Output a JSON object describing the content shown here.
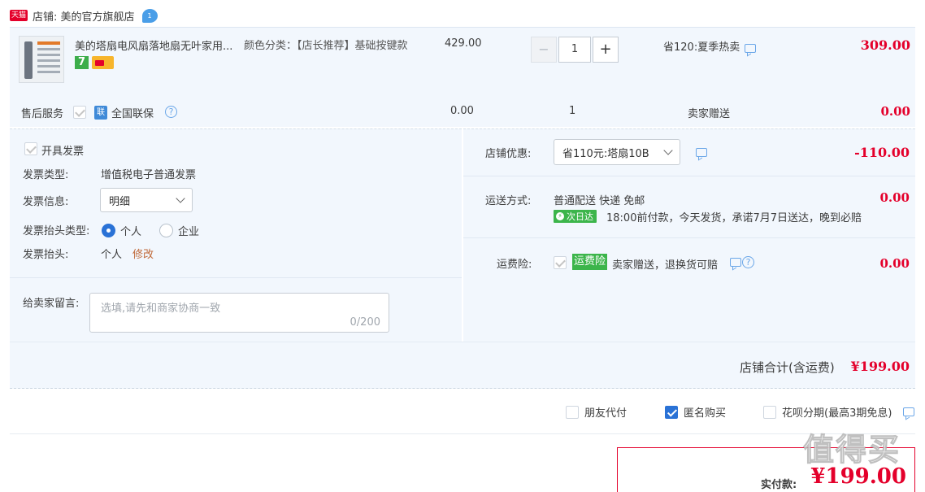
{
  "shop": {
    "badge": "天猫",
    "label": "店铺: 美的官方旗舰店",
    "chat_badge": "1"
  },
  "item": {
    "title": "美的塔扇电风扇落地扇无叶家用...",
    "icon_7": "7",
    "sku_label": "颜色分类：【店长推荐】基础按键款",
    "unit_price": "429.00",
    "quantity": "1",
    "minus": "−",
    "plus": "+",
    "promo": "省120:夏季热卖",
    "subtotal": "309.00"
  },
  "after_sale": {
    "label": "售后服务",
    "service": "全国联保",
    "service_icon_text": "联",
    "price": "0.00",
    "qty": "1",
    "gift": "卖家赠送",
    "amount": "0.00"
  },
  "invoice": {
    "open_label": "开具发票",
    "type_label": "发票类型:",
    "type_value": "增值税电子普通发票",
    "info_label": "发票信息:",
    "info_value": "明细",
    "header_type_label": "发票抬头类型:",
    "personal": "个人",
    "company": "企业",
    "header_label": "发票抬头:",
    "header_value": "个人",
    "edit": "修改"
  },
  "message": {
    "label": "给卖家留言:",
    "placeholder": "选填,请先和商家协商一致",
    "counter": "0/200"
  },
  "discount": {
    "label": "店铺优惠:",
    "value": "省110元:塔扇10B",
    "amount": "-110.00"
  },
  "shipping": {
    "label": "运送方式:",
    "method": "普通配送 快递 免邮",
    "badge": "次日达",
    "desc": "18:00前付款，今天发货，承诺7月7日送达，晚到必赔",
    "amount": "0.00"
  },
  "insurance": {
    "label": "运费险:",
    "badge": "运费险",
    "desc": "卖家赠送，退换货可赔",
    "amount": "0.00"
  },
  "total": {
    "label": "店铺合计(含运费)",
    "value": "¥199.00"
  },
  "options": {
    "friend_pay": "朋友代付",
    "anonymous": "匿名购买",
    "huabei": "花呗分期(最高3期免息)"
  },
  "pay": {
    "label": "实付款:",
    "value": "¥199.00"
  },
  "watermark": "值得买"
}
